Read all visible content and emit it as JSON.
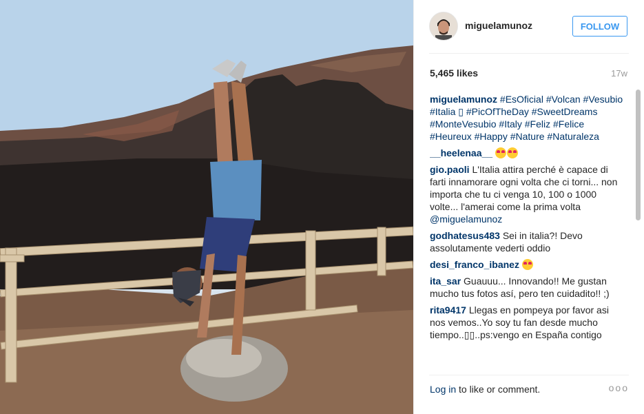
{
  "post": {
    "username": "miguelamunoz",
    "follow_label": "FOLLOW",
    "likes": "5,465 likes",
    "time_ago": "17w"
  },
  "caption": {
    "user": "miguelamunoz",
    "text": "#EsOficial #Volcan #Vesubio #Italia ▯ #PicOfTheDay #SweetDreams #MonteVesubio #Italy #Feliz #Felice #Heureux #Happy #Nature #Naturaleza"
  },
  "comments": [
    {
      "user": "__heelenaa__",
      "text": "",
      "emoji_count": 2
    },
    {
      "user": "gio.paoli",
      "text": "L'Italia attira perché è capace di farti innamorare ogni volta che ci torni... non importa che tu ci venga 10, 100 o 1000 volte... l'amerai come la prima volta",
      "mention": "@miguelamunoz"
    },
    {
      "user": "godhatesus483",
      "text": "Sei in italia?! Devo assolutamente vederti oddio"
    },
    {
      "user": "desi_franco_ibanez",
      "text": "",
      "emoji_count": 1
    },
    {
      "user": "ita_sar",
      "text": "Guauuu... Innovando!! Me gustan mucho tus fotos así, pero ten cuidadito!! ;)"
    },
    {
      "user": "rita9417",
      "text": "Llegas en pompeya por favor asi nos vemos..Yo soy tu fan desde mucho tiempo..▯▯..ps:vengo en España contigo"
    }
  ],
  "footer": {
    "login_label": "Log in",
    "login_suffix": " to like or comment.",
    "more_label": "ooo"
  },
  "colors": {
    "link": "#003569",
    "accent": "#3897f0"
  }
}
